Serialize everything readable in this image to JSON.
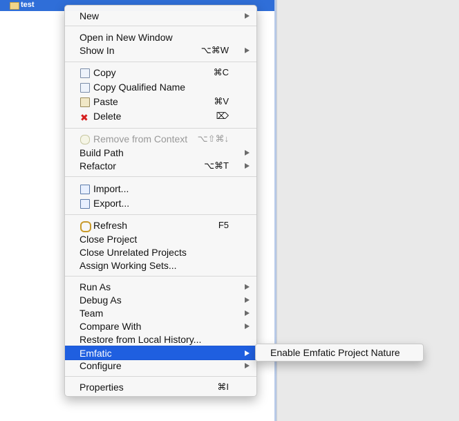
{
  "tree": {
    "project_label": "test"
  },
  "menu": {
    "items": [
      {
        "label": "New",
        "shortcut": "",
        "submenu": true
      },
      {
        "label": "Open in New Window",
        "shortcut": "",
        "submenu": false
      },
      {
        "label": "Show In",
        "shortcut": "⌥⌘W",
        "submenu": true
      },
      {
        "label": "Copy",
        "shortcut": "⌘C",
        "submenu": false,
        "icon": "copy-icon"
      },
      {
        "label": "Copy Qualified Name",
        "shortcut": "",
        "submenu": false,
        "icon": "copy-qualified-name-icon"
      },
      {
        "label": "Paste",
        "shortcut": "⌘V",
        "submenu": false,
        "icon": "paste-icon"
      },
      {
        "label": "Delete",
        "shortcut": "⌦",
        "submenu": false,
        "icon": "delete-icon"
      },
      {
        "label": "Remove from Context",
        "shortcut": "⌥⇧⌘↓",
        "submenu": false,
        "icon": "remove-from-context-icon",
        "disabled": true
      },
      {
        "label": "Build Path",
        "shortcut": "",
        "submenu": true
      },
      {
        "label": "Refactor",
        "shortcut": "⌥⌘T",
        "submenu": true
      },
      {
        "label": "Import...",
        "shortcut": "",
        "submenu": false,
        "icon": "import-icon"
      },
      {
        "label": "Export...",
        "shortcut": "",
        "submenu": false,
        "icon": "export-icon"
      },
      {
        "label": "Refresh",
        "shortcut": "F5",
        "submenu": false,
        "icon": "refresh-icon"
      },
      {
        "label": "Close Project",
        "shortcut": "",
        "submenu": false
      },
      {
        "label": "Close Unrelated Projects",
        "shortcut": "",
        "submenu": false
      },
      {
        "label": "Assign Working Sets...",
        "shortcut": "",
        "submenu": false
      },
      {
        "label": "Run As",
        "shortcut": "",
        "submenu": true
      },
      {
        "label": "Debug As",
        "shortcut": "",
        "submenu": true
      },
      {
        "label": "Team",
        "shortcut": "",
        "submenu": true
      },
      {
        "label": "Compare With",
        "shortcut": "",
        "submenu": true
      },
      {
        "label": "Restore from Local History...",
        "shortcut": "",
        "submenu": false
      },
      {
        "label": "Emfatic",
        "shortcut": "",
        "submenu": true,
        "highlighted": true
      },
      {
        "label": "Configure",
        "shortcut": "",
        "submenu": true
      },
      {
        "label": "Properties",
        "shortcut": "⌘I",
        "submenu": false
      }
    ]
  },
  "submenu": {
    "items": [
      {
        "label": "Enable Emfatic Project Nature"
      }
    ]
  },
  "colors": {
    "highlight": "#1f5fe0",
    "selection": "#2f6ed8",
    "menu_bg": "#f7f7f7",
    "right_pane": "#e9e9e9"
  }
}
